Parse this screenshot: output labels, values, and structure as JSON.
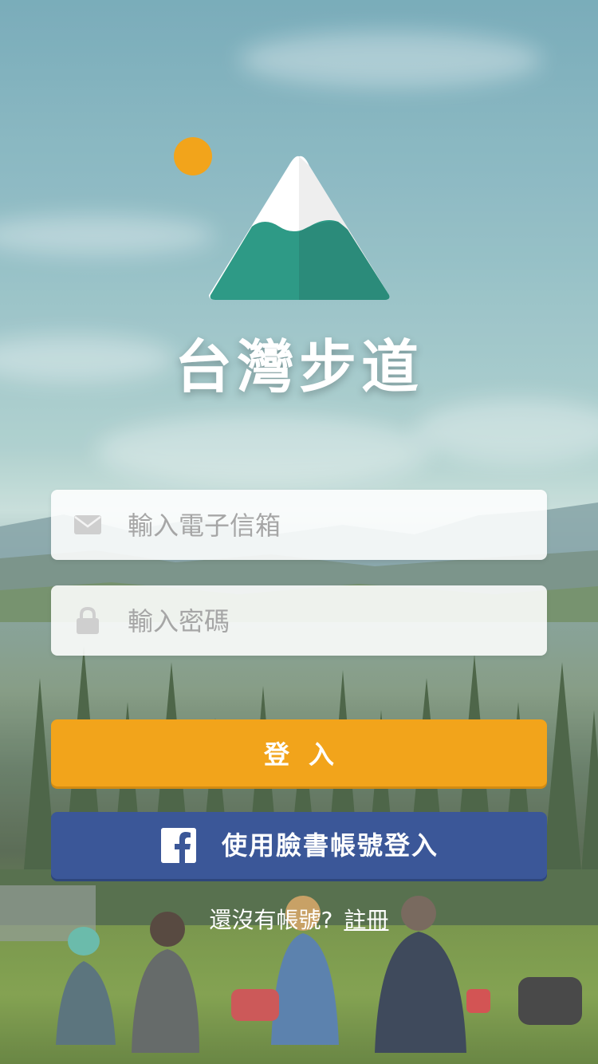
{
  "app": {
    "title": "台灣步道"
  },
  "form": {
    "email_placeholder": "輸入電子信箱",
    "password_placeholder": "輸入密碼"
  },
  "buttons": {
    "login_label": "登入",
    "facebook_label": "使用臉書帳號登入"
  },
  "signup": {
    "prompt": "還沒有帳號?",
    "link_label": "註冊"
  },
  "icons": {
    "email": "mail-icon",
    "password": "lock-icon",
    "facebook": "facebook-icon",
    "logo": "mountain-sun-logo"
  },
  "colors": {
    "accent": "#f2a41b",
    "facebook": "#3b5798",
    "mountain_green": "#2e9a86",
    "sun": "#f2a41b"
  }
}
